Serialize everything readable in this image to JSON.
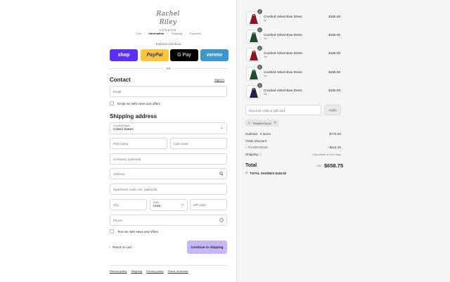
{
  "brand": {
    "script": "Rachel Riley",
    "sub": "LONDON"
  },
  "breadcrumb": [
    {
      "label": "Cart",
      "active": false
    },
    {
      "label": "Information",
      "active": true
    },
    {
      "label": "Shipping",
      "active": false
    },
    {
      "label": "Payment",
      "active": false
    }
  ],
  "express": {
    "title": "Express checkout",
    "shop": "shop",
    "paypal": "PayPal",
    "gpay": "G Pay",
    "venmo": "venmo",
    "or": "OR"
  },
  "contact": {
    "heading": "Contact",
    "signin": "Sign in",
    "email_placeholder": "Email",
    "news_label": "Email me with news and offers"
  },
  "shipping": {
    "heading": "Shipping address",
    "country_label": "Country/Region",
    "country_value": "United States",
    "first_name": "First name",
    "last_name": "Last name",
    "company": "Company (optional)",
    "address": "Address",
    "apartment": "Apartment, suite, etc. (optional)",
    "city": "City",
    "state_label": "State",
    "state_value": "Iowa",
    "zip": "ZIP code",
    "phone": "Phone",
    "text_label": "Text me with news and offers"
  },
  "actions": {
    "return_label": "Return to cart",
    "continue_label": "Continue to shipping"
  },
  "footer": [
    "Refund policy",
    "Shipping",
    "Privacy policy",
    "Terms of service"
  ],
  "cart": {
    "items": [
      {
        "qty": "1",
        "name": "Crushed Velvet Bow Dress",
        "variant": "3y",
        "price": "$155.00",
        "color": "#8c1620"
      },
      {
        "qty": "1",
        "name": "Crushed Velvet Bow Dress",
        "variant": "3m",
        "price": "$155.00",
        "color": "#1d4d2b"
      },
      {
        "qty": "1",
        "name": "Crushed Velvet Bow Dress",
        "variant": "4m",
        "price": "$155.00",
        "color": "#8c1620"
      },
      {
        "qty": "1",
        "name": "Crushed Velvet Bow Dress",
        "variant": "6m",
        "price": "$155.00",
        "color": "#1d4d2b"
      },
      {
        "qty": "1",
        "name": "Crushed Velvet Bow Dress",
        "variant": "3m",
        "price": "$155.00",
        "color": "#22224a"
      }
    ],
    "discount_placeholder": "Discount code or gift card",
    "apply_label": "Apply",
    "code_tag": "THANKYOU15",
    "subtotal_label": "Subtotal · 5 items",
    "subtotal_value": "$775.00",
    "order_discount_label": "Order discount",
    "code_line": "THANKYOU15",
    "discount_value": "−$116.25",
    "shipping_label": "Shipping",
    "shipping_value": "Calculated at next step",
    "total_label": "Total",
    "currency": "USD",
    "total_value": "$658.75",
    "savings_label": "TOTAL SAVINGS",
    "savings_value": "$116.25"
  },
  "colors": {
    "accent": "#c7b7f6",
    "shop": "#5a31f4",
    "paypal": "#ffc439",
    "venmo": "#3d95ce"
  }
}
